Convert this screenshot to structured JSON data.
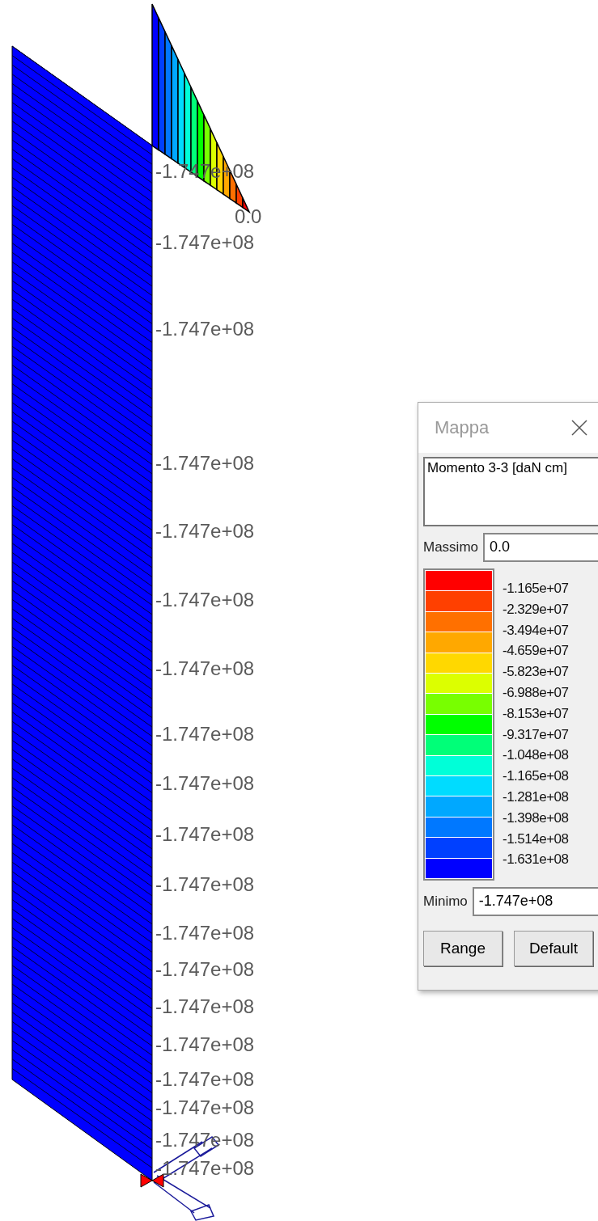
{
  "diagram": {
    "labels": [
      {
        "text": "-1.747e+08",
        "kind": "value"
      },
      {
        "text": "0.0",
        "kind": "zero"
      },
      {
        "text": "-1.747e+08",
        "kind": "value"
      },
      {
        "text": "-1.747e+08",
        "kind": "value"
      },
      {
        "text": "-1.747e+08",
        "kind": "value"
      },
      {
        "text": "-1.747e+08",
        "kind": "value"
      },
      {
        "text": "-1.747e+08",
        "kind": "value"
      },
      {
        "text": "-1.747e+08",
        "kind": "value"
      },
      {
        "text": "-1.747e+08",
        "kind": "value"
      },
      {
        "text": "-1.747e+08",
        "kind": "value"
      },
      {
        "text": "-1.747e+08",
        "kind": "value"
      },
      {
        "text": "-1.747e+08",
        "kind": "value"
      },
      {
        "text": "-1.747e+08",
        "kind": "value"
      },
      {
        "text": "-1.747e+08",
        "kind": "value"
      },
      {
        "text": "-1.747e+08",
        "kind": "value"
      },
      {
        "text": "-1.747e+08",
        "kind": "value"
      },
      {
        "text": "-1.747e+08",
        "kind": "value"
      },
      {
        "text": "-1.747e+08",
        "kind": "value"
      },
      {
        "text": "-1.747e+08",
        "kind": "value"
      },
      {
        "text": "-1.747e+08",
        "kind": "value"
      }
    ]
  },
  "dialog": {
    "title": "Mappa",
    "quantity": "Momento 3-3 [daN cm]",
    "max_label": "Massimo",
    "max_value": "0.0",
    "swatches": [
      {
        "color": "#ff0000"
      },
      {
        "color": "#ff4000"
      },
      {
        "color": "#ff7000"
      },
      {
        "color": "#ffa800"
      },
      {
        "color": "#ffd800"
      },
      {
        "color": "#dcff00"
      },
      {
        "color": "#78ff00"
      },
      {
        "color": "#00ff00"
      },
      {
        "color": "#00ff78"
      },
      {
        "color": "#00ffd8"
      },
      {
        "color": "#00dcff"
      },
      {
        "color": "#00a8ff"
      },
      {
        "color": "#0078ff"
      },
      {
        "color": "#0040ff"
      },
      {
        "color": "#0000ff"
      }
    ],
    "levels": [
      "-1.165e+07",
      "-2.329e+07",
      "-3.494e+07",
      "-4.659e+07",
      "-5.823e+07",
      "-6.988e+07",
      "-8.153e+07",
      "-9.317e+07",
      "-1.048e+08",
      "-1.165e+08",
      "-1.281e+08",
      "-1.398e+08",
      "-1.514e+08",
      "-1.631e+08"
    ],
    "min_label": "Minimo",
    "min_value": "-1.747e+08",
    "buttons": [
      "Range",
      "Default"
    ]
  }
}
